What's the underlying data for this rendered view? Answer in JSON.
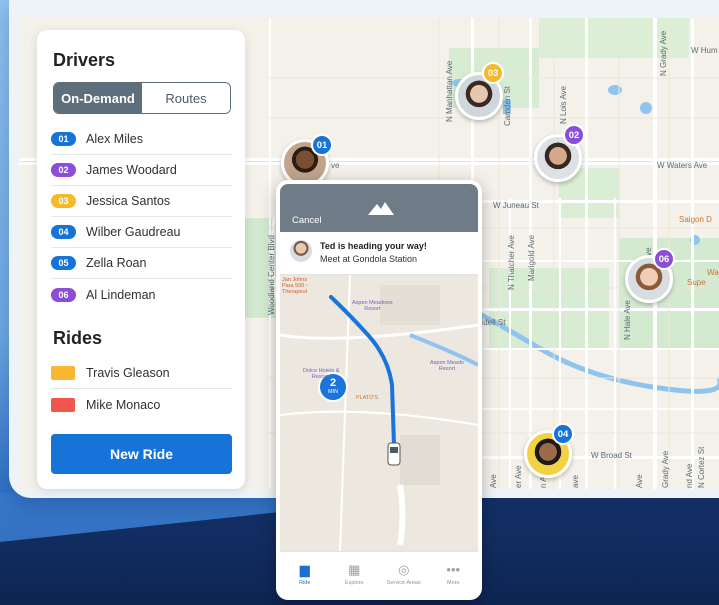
{
  "drivers_panel": {
    "title": "Drivers",
    "tabs": [
      {
        "label": "On-Demand",
        "active": true
      },
      {
        "label": "Routes",
        "active": false
      }
    ],
    "drivers": [
      {
        "num": "01",
        "name": "Alex Miles",
        "color": "#1673d8"
      },
      {
        "num": "02",
        "name": "James Woodard",
        "color": "#8a4fd6"
      },
      {
        "num": "03",
        "name": "Jessica Santos",
        "color": "#f5b92c"
      },
      {
        "num": "04",
        "name": "Wilber Gaudreau",
        "color": "#1673d8"
      },
      {
        "num": "05",
        "name": "Zella Roan",
        "color": "#1673d8"
      },
      {
        "num": "06",
        "name": "Al Lindeman",
        "color": "#8a4fd6"
      }
    ],
    "rides_title": "Rides",
    "rides": [
      {
        "name": "Travis Gleason",
        "color": "#f7b731"
      },
      {
        "name": "Mike Monaco",
        "color": "#f2554b"
      }
    ],
    "new_ride_label": "New Ride"
  },
  "phone": {
    "cancel_label": "Cancel",
    "notice_title": "Ted is heading your way!",
    "notice_sub": "Meet at Gondola Station",
    "eta_value": "2",
    "eta_unit": "MIN",
    "pois": [
      "Jan Johns\nPara 500 -\nTherapeut",
      "Aspen Meadows\nResort",
      "Dolce Hotels &\nResorts",
      "Aspen Meado\nResort",
      "PLATO'S"
    ],
    "tabs": [
      {
        "label": "Ride",
        "icon": "car-icon",
        "active": true
      },
      {
        "label": "Explore",
        "icon": "map-icon",
        "active": false
      },
      {
        "label": "Service Areas",
        "icon": "area-icon",
        "active": false
      },
      {
        "label": "More",
        "icon": "more-icon",
        "active": false
      }
    ]
  },
  "map": {
    "streets": {
      "manhattan": "N Manhattan Ave",
      "camden": "Camden St",
      "lois": "N Lois Ave",
      "grady": "N Grady Ave",
      "w_hum": "W Hum",
      "waters": "W Waters Ave",
      "juneau": "W Juneau St",
      "thatcher": "N Thatcher Ave",
      "marigold": "Marigold Ave",
      "woodland": "Woodland Center Blvd",
      "hale": "N Hale Ave",
      "idell": "Idell St",
      "broad": "W Broad St",
      "grady2": "Grady Ave",
      "cortez": "N Cortez St",
      "ave1": "Ave",
      "ave2": "er Ave",
      "ave3": "n Ave",
      "ave4": "ave",
      "ave5": "Ave",
      "ave6": "nd Ave",
      "ave7": "ve",
      "ave8": "om Ave",
      "saigon": "Saigon D",
      "wa": "Wa",
      "supe": "Supe"
    },
    "markers": [
      {
        "num": "01",
        "color": "#1673d8"
      },
      {
        "num": "03",
        "color": "#f5b92c"
      },
      {
        "num": "02",
        "color": "#8a4fd6"
      },
      {
        "num": "06",
        "color": "#8a4fd6"
      },
      {
        "num": "04",
        "color": "#1673d8"
      }
    ]
  }
}
